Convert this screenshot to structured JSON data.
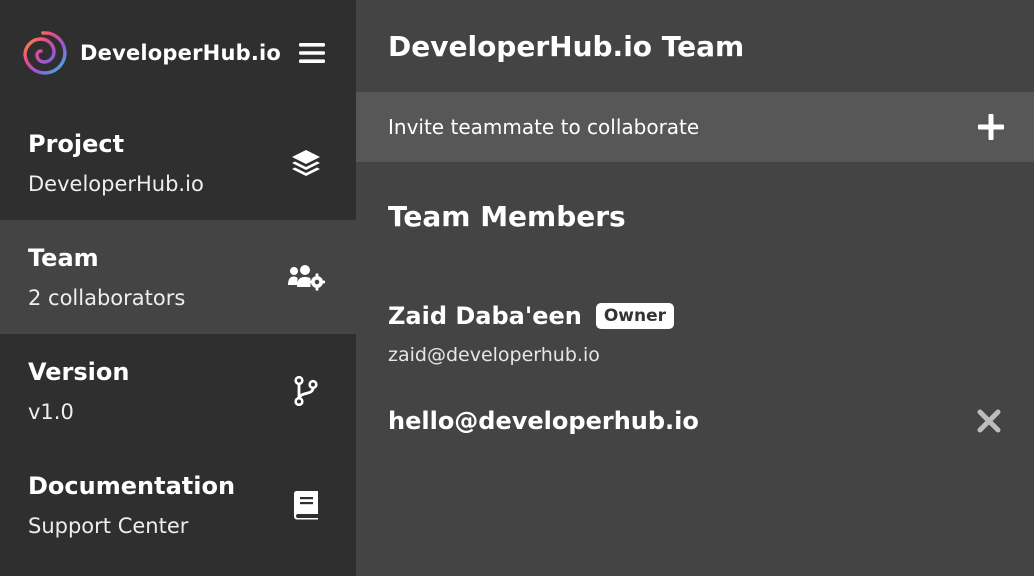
{
  "brand": {
    "name": "DeveloperHub.io"
  },
  "sidebar": {
    "items": [
      {
        "title": "Project",
        "subtitle": "DeveloperHub.io",
        "icon": "layers-icon"
      },
      {
        "title": "Team",
        "subtitle": "2 collaborators",
        "icon": "users-cog-icon",
        "active": true
      },
      {
        "title": "Version",
        "subtitle": "v1.0",
        "icon": "code-branch-icon"
      },
      {
        "title": "Documentation",
        "subtitle": "Support Center",
        "icon": "book-icon"
      }
    ]
  },
  "main": {
    "title": "DeveloperHub.io Team",
    "invite_label": "Invite teammate to collaborate",
    "members_heading": "Team Members",
    "members": [
      {
        "name": "Zaid Daba'een",
        "badge": "Owner",
        "email": "zaid@developerhub.io"
      },
      {
        "name": "hello@developerhub.io"
      }
    ]
  },
  "colors": {
    "sidebar_bg": "#2f2f2f",
    "main_bg": "#444444",
    "invite_bg": "#575757",
    "remove_icon": "#bdbdbd"
  }
}
